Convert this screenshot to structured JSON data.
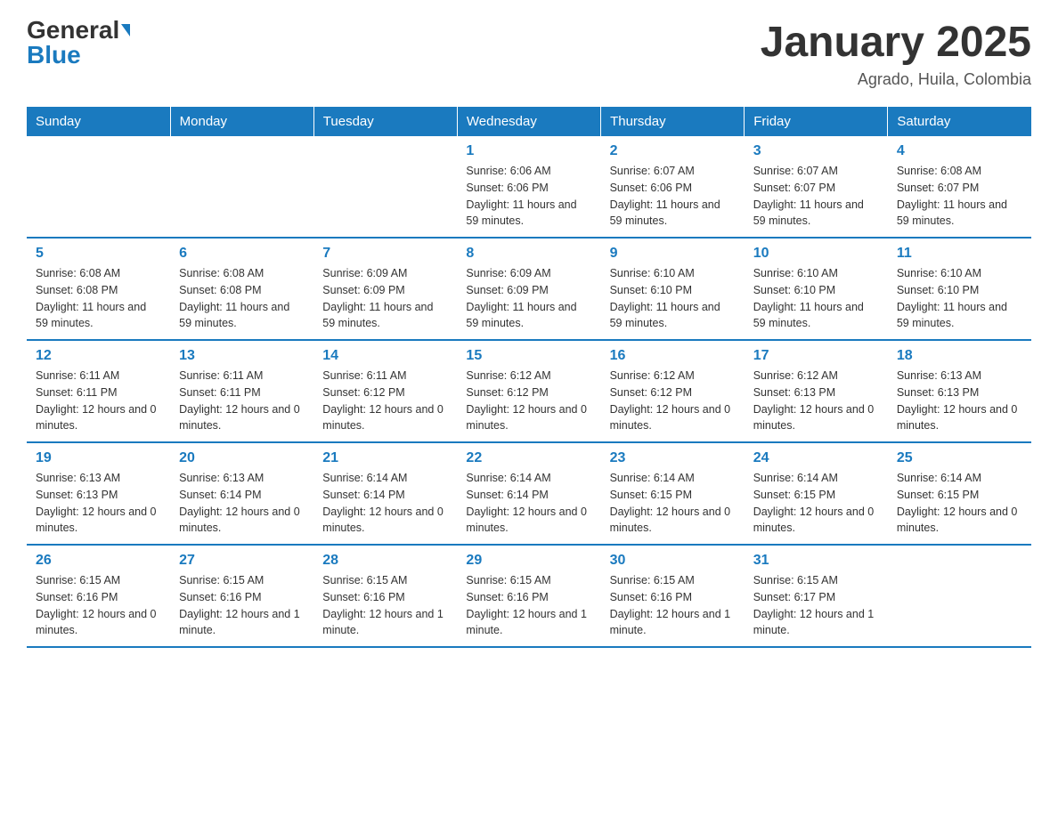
{
  "logo": {
    "general": "General",
    "blue": "Blue"
  },
  "title": "January 2025",
  "location": "Agrado, Huila, Colombia",
  "days_of_week": [
    "Sunday",
    "Monday",
    "Tuesday",
    "Wednesday",
    "Thursday",
    "Friday",
    "Saturday"
  ],
  "weeks": [
    [
      {
        "day": "",
        "info": ""
      },
      {
        "day": "",
        "info": ""
      },
      {
        "day": "",
        "info": ""
      },
      {
        "day": "1",
        "info": "Sunrise: 6:06 AM\nSunset: 6:06 PM\nDaylight: 11 hours and 59 minutes."
      },
      {
        "day": "2",
        "info": "Sunrise: 6:07 AM\nSunset: 6:06 PM\nDaylight: 11 hours and 59 minutes."
      },
      {
        "day": "3",
        "info": "Sunrise: 6:07 AM\nSunset: 6:07 PM\nDaylight: 11 hours and 59 minutes."
      },
      {
        "day": "4",
        "info": "Sunrise: 6:08 AM\nSunset: 6:07 PM\nDaylight: 11 hours and 59 minutes."
      }
    ],
    [
      {
        "day": "5",
        "info": "Sunrise: 6:08 AM\nSunset: 6:08 PM\nDaylight: 11 hours and 59 minutes."
      },
      {
        "day": "6",
        "info": "Sunrise: 6:08 AM\nSunset: 6:08 PM\nDaylight: 11 hours and 59 minutes."
      },
      {
        "day": "7",
        "info": "Sunrise: 6:09 AM\nSunset: 6:09 PM\nDaylight: 11 hours and 59 minutes."
      },
      {
        "day": "8",
        "info": "Sunrise: 6:09 AM\nSunset: 6:09 PM\nDaylight: 11 hours and 59 minutes."
      },
      {
        "day": "9",
        "info": "Sunrise: 6:10 AM\nSunset: 6:10 PM\nDaylight: 11 hours and 59 minutes."
      },
      {
        "day": "10",
        "info": "Sunrise: 6:10 AM\nSunset: 6:10 PM\nDaylight: 11 hours and 59 minutes."
      },
      {
        "day": "11",
        "info": "Sunrise: 6:10 AM\nSunset: 6:10 PM\nDaylight: 11 hours and 59 minutes."
      }
    ],
    [
      {
        "day": "12",
        "info": "Sunrise: 6:11 AM\nSunset: 6:11 PM\nDaylight: 12 hours and 0 minutes."
      },
      {
        "day": "13",
        "info": "Sunrise: 6:11 AM\nSunset: 6:11 PM\nDaylight: 12 hours and 0 minutes."
      },
      {
        "day": "14",
        "info": "Sunrise: 6:11 AM\nSunset: 6:12 PM\nDaylight: 12 hours and 0 minutes."
      },
      {
        "day": "15",
        "info": "Sunrise: 6:12 AM\nSunset: 6:12 PM\nDaylight: 12 hours and 0 minutes."
      },
      {
        "day": "16",
        "info": "Sunrise: 6:12 AM\nSunset: 6:12 PM\nDaylight: 12 hours and 0 minutes."
      },
      {
        "day": "17",
        "info": "Sunrise: 6:12 AM\nSunset: 6:13 PM\nDaylight: 12 hours and 0 minutes."
      },
      {
        "day": "18",
        "info": "Sunrise: 6:13 AM\nSunset: 6:13 PM\nDaylight: 12 hours and 0 minutes."
      }
    ],
    [
      {
        "day": "19",
        "info": "Sunrise: 6:13 AM\nSunset: 6:13 PM\nDaylight: 12 hours and 0 minutes."
      },
      {
        "day": "20",
        "info": "Sunrise: 6:13 AM\nSunset: 6:14 PM\nDaylight: 12 hours and 0 minutes."
      },
      {
        "day": "21",
        "info": "Sunrise: 6:14 AM\nSunset: 6:14 PM\nDaylight: 12 hours and 0 minutes."
      },
      {
        "day": "22",
        "info": "Sunrise: 6:14 AM\nSunset: 6:14 PM\nDaylight: 12 hours and 0 minutes."
      },
      {
        "day": "23",
        "info": "Sunrise: 6:14 AM\nSunset: 6:15 PM\nDaylight: 12 hours and 0 minutes."
      },
      {
        "day": "24",
        "info": "Sunrise: 6:14 AM\nSunset: 6:15 PM\nDaylight: 12 hours and 0 minutes."
      },
      {
        "day": "25",
        "info": "Sunrise: 6:14 AM\nSunset: 6:15 PM\nDaylight: 12 hours and 0 minutes."
      }
    ],
    [
      {
        "day": "26",
        "info": "Sunrise: 6:15 AM\nSunset: 6:16 PM\nDaylight: 12 hours and 0 minutes."
      },
      {
        "day": "27",
        "info": "Sunrise: 6:15 AM\nSunset: 6:16 PM\nDaylight: 12 hours and 1 minute."
      },
      {
        "day": "28",
        "info": "Sunrise: 6:15 AM\nSunset: 6:16 PM\nDaylight: 12 hours and 1 minute."
      },
      {
        "day": "29",
        "info": "Sunrise: 6:15 AM\nSunset: 6:16 PM\nDaylight: 12 hours and 1 minute."
      },
      {
        "day": "30",
        "info": "Sunrise: 6:15 AM\nSunset: 6:16 PM\nDaylight: 12 hours and 1 minute."
      },
      {
        "day": "31",
        "info": "Sunrise: 6:15 AM\nSunset: 6:17 PM\nDaylight: 12 hours and 1 minute."
      },
      {
        "day": "",
        "info": ""
      }
    ]
  ]
}
